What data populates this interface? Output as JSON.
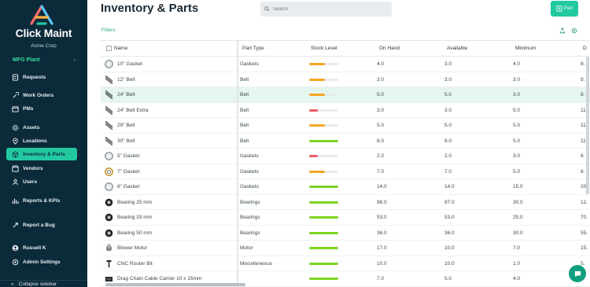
{
  "brand": {
    "name": "Click Maint",
    "company": "Acme Corp",
    "logo_colors": [
      "#ff6b6b",
      "#ffb347",
      "#22c9a0",
      "#5cc8ff"
    ]
  },
  "sidebar": {
    "plant": "MFG Plant",
    "items": [
      {
        "label": "Requests",
        "icon": "requests-icon"
      },
      {
        "label": "Work Orders",
        "icon": "work-orders-icon"
      },
      {
        "label": "PMs",
        "icon": "pms-icon"
      },
      {
        "label": "Assets",
        "icon": "assets-icon"
      },
      {
        "label": "Locations",
        "icon": "locations-icon"
      },
      {
        "label": "Inventory & Parts",
        "icon": "inventory-icon",
        "active": true
      },
      {
        "label": "Vendors",
        "icon": "vendors-icon"
      },
      {
        "label": "Users",
        "icon": "users-icon"
      },
      {
        "label": "Reports & KPIs",
        "icon": "reports-icon"
      },
      {
        "label": "Report a Bug",
        "icon": "bug-icon"
      },
      {
        "label": "Russell K",
        "icon": "user-icon"
      },
      {
        "label": "Admin Settings",
        "icon": "settings-icon"
      }
    ],
    "collapse_label": "Collapse sidebar"
  },
  "header": {
    "title": "Inventory & Parts",
    "search_placeholder": "Search",
    "add_button_label": "Part",
    "filters_label": "Filters"
  },
  "table": {
    "columns": [
      "Name",
      "Part Type",
      "Stock Level",
      "On Hand",
      "Available",
      "Minimum",
      "D"
    ],
    "rows": [
      {
        "name": "10\" Gasket",
        "type": "Gaskets",
        "stock": 0.55,
        "stock_color": "#f5a623",
        "on_hand": "4.0",
        "available": "3.0",
        "minimum": "4.0",
        "extra": "8.",
        "thumb": "gasket"
      },
      {
        "name": "12\" Belt",
        "type": "Belt",
        "stock": 0.55,
        "stock_color": "#f5a623",
        "on_hand": "3.0",
        "available": "3.0",
        "minimum": "3.0",
        "extra": "9.",
        "thumb": "belt"
      },
      {
        "name": "24\" Belt",
        "type": "Belt",
        "stock": 0.55,
        "stock_color": "#f5a623",
        "on_hand": "5.0",
        "available": "5.0",
        "minimum": "3.0",
        "extra": "9.",
        "thumb": "belt",
        "highlight": true
      },
      {
        "name": "24\" Belt Extra",
        "type": "Belt",
        "stock": 0.3,
        "stock_color": "#ee5a6a",
        "on_hand": "3.0",
        "available": "3.0",
        "minimum": "5.0",
        "extra": "11.",
        "thumb": "belt"
      },
      {
        "name": "29\" Belt",
        "type": "Belt",
        "stock": 0.55,
        "stock_color": "#f5a623",
        "on_hand": "5.0",
        "available": "5.0",
        "minimum": "5.0",
        "extra": "11.",
        "thumb": "belt"
      },
      {
        "name": "30\" Belt",
        "type": "Belt",
        "stock": 1.0,
        "stock_color": "#7ed321",
        "on_hand": "8.0",
        "available": "8.0",
        "minimum": "5.0",
        "extra": "11.",
        "thumb": "belt"
      },
      {
        "name": "5\" Gasket",
        "type": "Gaskets",
        "stock": 0.3,
        "stock_color": "#ee5a6a",
        "on_hand": "2.0",
        "available": "2.0",
        "minimum": "3.0",
        "extra": "8.",
        "thumb": "gasket"
      },
      {
        "name": "7\" Gasket",
        "type": "Gaskets",
        "stock": 0.55,
        "stock_color": "#f5a623",
        "on_hand": "7.0",
        "available": "7.0",
        "minimum": "5.0",
        "extra": "8.",
        "thumb": "gasket-gold"
      },
      {
        "name": "8\" Gasket",
        "type": "Gaskets",
        "stock": 1.0,
        "stock_color": "#7ed321",
        "on_hand": "14.0",
        "available": "14.0",
        "minimum": "15.0",
        "extra": "20.",
        "thumb": "gasket"
      },
      {
        "name": "Bearing 25 mm",
        "type": "Bearings",
        "stock": 1.0,
        "stock_color": "#7ed321",
        "on_hand": "98.0",
        "available": "97.0",
        "minimum": "30.0",
        "extra": "12.",
        "thumb": "bearing"
      },
      {
        "name": "Bearing 33 mm",
        "type": "Bearings",
        "stock": 1.0,
        "stock_color": "#7ed321",
        "on_hand": "53.0",
        "available": "53.0",
        "minimum": "25.0",
        "extra": "70.",
        "thumb": "bearing"
      },
      {
        "name": "Bearing 50 mm",
        "type": "Bearings",
        "stock": 1.0,
        "stock_color": "#7ed321",
        "on_hand": "36.0",
        "available": "36.0",
        "minimum": "30.0",
        "extra": "55.",
        "thumb": "bearing"
      },
      {
        "name": "Blower Motor",
        "type": "Motor",
        "stock": 1.0,
        "stock_color": "#7ed321",
        "on_hand": "17.0",
        "available": "10.0",
        "minimum": "7.0",
        "extra": "15.",
        "thumb": "motor"
      },
      {
        "name": "CNC Router Bit",
        "type": "Miscelleneous",
        "stock": 1.0,
        "stock_color": "#7ed321",
        "on_hand": "10.0",
        "available": "10.0",
        "minimum": "1.0",
        "extra": "5.",
        "thumb": "bit"
      },
      {
        "name": "Drag Chain Cable Carrier 10 x 15mm",
        "type": "",
        "stock": 1.0,
        "stock_color": "#7ed321",
        "on_hand": "7.0",
        "available": "5.0",
        "minimum": "4.0",
        "extra": "",
        "thumb": "chain"
      }
    ]
  },
  "colors": {
    "sidebar_bg": "#0b2a3a",
    "accent": "#22c9a0",
    "highlight_row": "#e4f6ef"
  }
}
